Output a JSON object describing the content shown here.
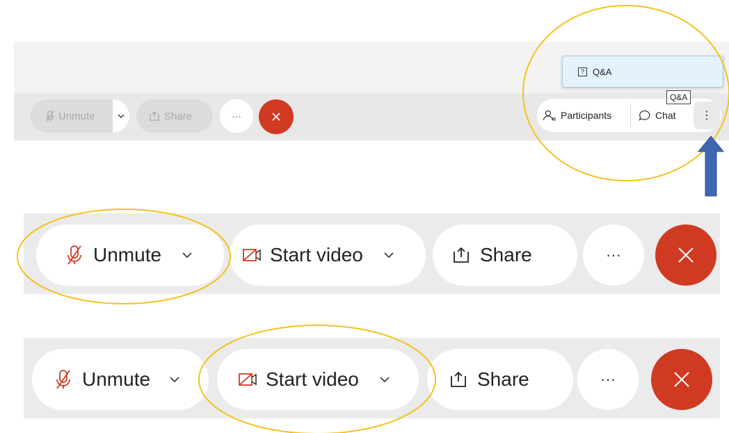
{
  "top_panel": {
    "unmute_label": "Unmute",
    "share_label": "Share",
    "more_label": "···",
    "participants_label": "Participants",
    "chat_label": "Chat",
    "kebab_label": "⋮",
    "qa_menu_label": "Q&A",
    "qa_tooltip": "Q&A"
  },
  "middle_panel": {
    "unmute_label": "Unmute",
    "start_video_label": "Start video",
    "share_label": "Share",
    "more_label": "···"
  },
  "bottom_panel": {
    "unmute_label": "Unmute",
    "start_video_label": "Start video",
    "share_label": "Share",
    "more_label": "···"
  },
  "colors": {
    "end_call": "#d13a22",
    "highlight": "#f4c21c",
    "arrow": "#3f67b1",
    "muted_icon": "#d13a22"
  }
}
